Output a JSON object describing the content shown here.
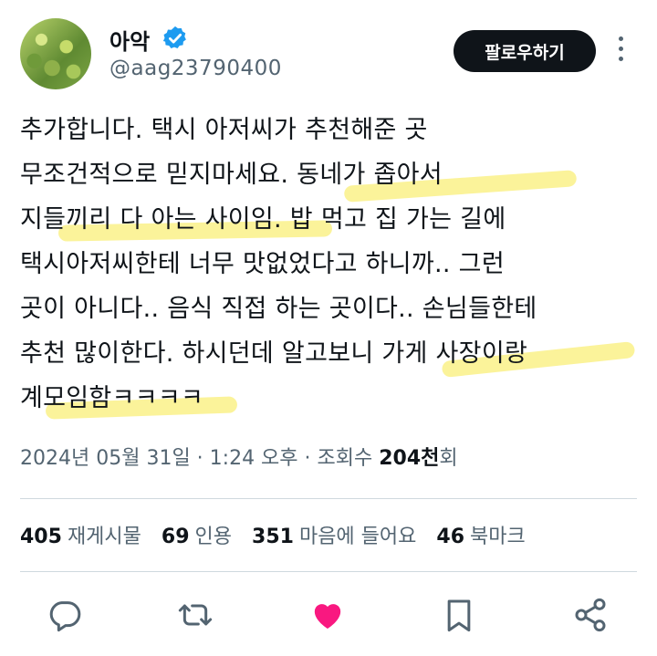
{
  "user": {
    "name": "아악",
    "handle": "@aag23790400",
    "verified": true,
    "follow_label": "팔로우하기"
  },
  "tweet": {
    "lines": [
      "추가합니다. 택시 아저씨가 추천해준 곳",
      "무조건적으로 믿지마세요. 동네가 좁아서",
      "지들끼리 다 아는 사이임. 밥 먹고 집 가는 길에",
      "택시아저씨한테 너무 맛없었다고 하니까.. 그런",
      "곳이 아니다.. 음식 직접 하는 곳이다.. 손님들한테",
      "추천 많이한다. 하시던데 알고보니 가게 사장이랑",
      "계모임함ㅋㅋㅋㅋ"
    ]
  },
  "meta": {
    "datetime": "2024년 05월 31일 · 1:24 오후 · 조회수 ",
    "views": "204천",
    "views_suffix": "회"
  },
  "stats": {
    "reposts_count": "405",
    "reposts_label": "재게시물",
    "quotes_count": "69",
    "quotes_label": "인용",
    "likes_count": "351",
    "likes_label": "마음에 들어요",
    "bookmarks_count": "46",
    "bookmarks_label": "북마크"
  },
  "colors": {
    "highlight": "#fbf28f",
    "like": "#f91880",
    "verified": "#1d9bf0",
    "muted": "#536471"
  },
  "icons": [
    "reply-icon",
    "repost-icon",
    "like-icon",
    "bookmark-icon",
    "share-icon",
    "verified-badge-icon",
    "more-icon"
  ]
}
